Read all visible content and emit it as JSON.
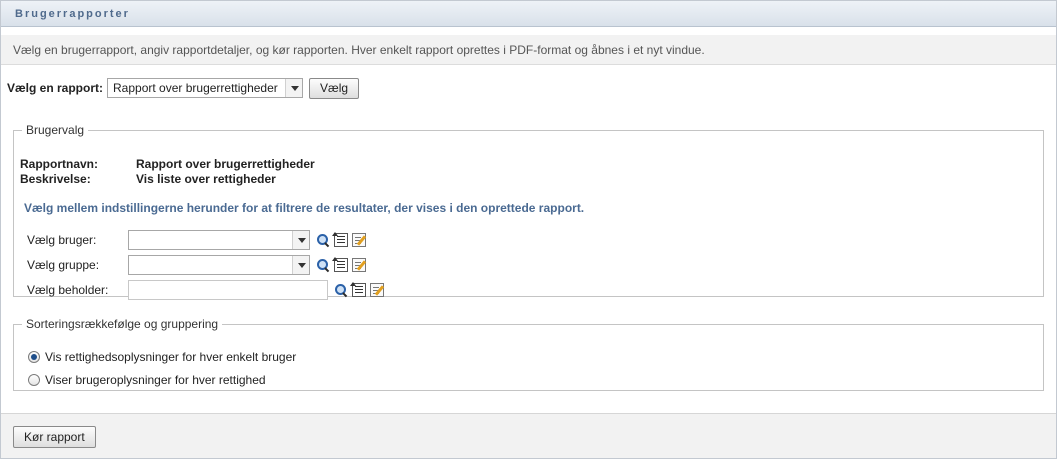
{
  "header": {
    "title": "Brugerrapporter"
  },
  "description": "Vælg en brugerrapport, angiv rapportdetaljer, og kør rapporten. Hver enkelt rapport oprettes i PDF-format og åbnes i et nyt vindue.",
  "report_chooser": {
    "label": "Vælg en rapport:",
    "selected": "Rapport over brugerrettigheder",
    "button": "Vælg"
  },
  "user_options": {
    "legend": "Brugervalg",
    "report_name_label": "Rapportnavn:",
    "report_name": "Rapport over brugerrettigheder",
    "description_label": "Beskrivelse:",
    "description": "Vis liste over rettigheder",
    "filter_hint": "Vælg mellem indstillingerne herunder for at filtrere de resultater, der vises i den oprettede rapport.",
    "user_label": "Vælg bruger:",
    "user_value": "",
    "group_label": "Vælg gruppe:",
    "group_value": "",
    "container_label": "Vælg beholder:",
    "container_value": ""
  },
  "sorting": {
    "legend": "Sorteringsrækkefølge og gruppering",
    "options": [
      {
        "label": "Vis rettighedsoplysninger for hver enkelt bruger",
        "selected": true
      },
      {
        "label": "Viser brugeroplysninger for hver rettighed",
        "selected": false
      }
    ]
  },
  "footer": {
    "run_button": "Kør rapport"
  },
  "icons": {
    "search": "search-icon",
    "history": "history-icon",
    "edit": "edit-icon"
  },
  "colors": {
    "title": "#4f6a8c",
    "hint": "#4a6a92",
    "radio_selected": "#1f4e8a"
  }
}
